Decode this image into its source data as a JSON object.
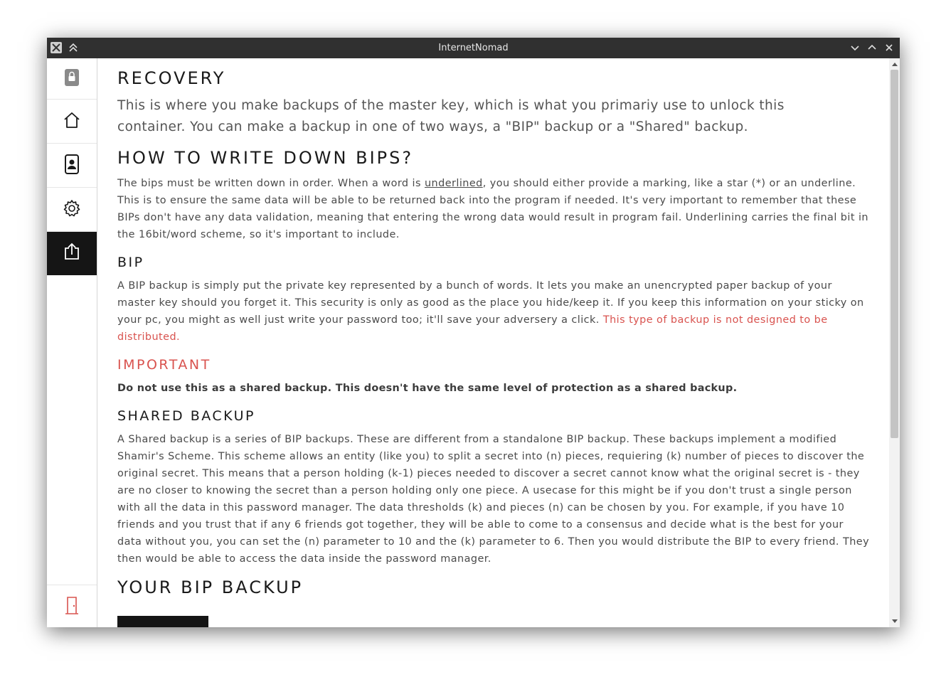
{
  "window": {
    "title": "InternetNomad"
  },
  "sidebar": {
    "items": [
      {
        "icon": "lock-icon",
        "label": "Lock"
      },
      {
        "icon": "home-icon",
        "label": "Home"
      },
      {
        "icon": "contacts-icon",
        "label": "Contacts"
      },
      {
        "icon": "gear-icon",
        "label": "Settings"
      },
      {
        "icon": "upload-icon",
        "label": "Recovery",
        "active": true
      },
      {
        "icon": "exit-door-icon",
        "label": "Exit"
      }
    ],
    "accent_active": "#151515",
    "exit_color": "#d9534f"
  },
  "content": {
    "recovery": {
      "heading": "RECOVERY",
      "text": "This is where you make backups of the master key, which is what you primariy use to unlock this container. You can make a backup in one of two ways, a \"BIP\" backup or a \"Shared\" backup."
    },
    "howto": {
      "heading": "HOW TO WRITE DOWN BIPS?",
      "text_pre": "The bips must be written down in order. When a word is ",
      "text_underlined": "underlined",
      "text_post": ", you should either provide a marking, like a star (*) or an underline. This is to ensure the same data will be able to be returned back into the program if needed. It's very important to remember that these BIPs don't have any data validation, meaning that entering the wrong data would result in program fail. Underlining carries the final bit in the 16bit/word scheme, so it's important to include."
    },
    "bip": {
      "heading": "BIP",
      "text": "A BIP backup is simply put the private key represented by a bunch of words. It lets you make an unencrypted paper backup of your master key should you forget it. This security is only as good as the place you hide/keep it. If you keep this information on your sticky on your pc, you might as well just write your password too; it'll save your adversery a click. ",
      "text_red": "This type of backup is not designed to be distributed."
    },
    "important": {
      "heading": "IMPORTANT",
      "text": "Do not use this as a shared backup. This doesn't have the same level of protection as a shared backup."
    },
    "shared": {
      "heading": "SHARED BACKUP",
      "text": "A Shared backup is a series of BIP backups. These are different from a standalone BIP backup. These backups implement a modified Shamir's Scheme. This scheme allows an entity (like you) to split a secret into (n) pieces, requiering (k) number of pieces to discover the original secret. This means that a person holding (k-1) pieces needed to discover a secret cannot know what the original secret is - they are no closer to knowing the secret than a person holding only one piece. A usecase for this might be if you don't trust a single person with all the data in this password manager. The data thresholds (k) and pieces (n) can be chosen by you. For example, if you have 10 friends and you trust that if any 6 friends got together, they will be able to come to a consensus and decide what is the best for your data without you, you can set the (n) parameter to 10 and the (k) parameter to 6. Then you would distribute the BIP to every friend. They then would be able to access the data inside the password manager."
    },
    "your_bip": {
      "heading": "YOUR BIP BACKUP"
    },
    "colors": {
      "warning": "#d9534f",
      "heading": "#1a1a1a",
      "body": "#4a4a4a"
    }
  }
}
